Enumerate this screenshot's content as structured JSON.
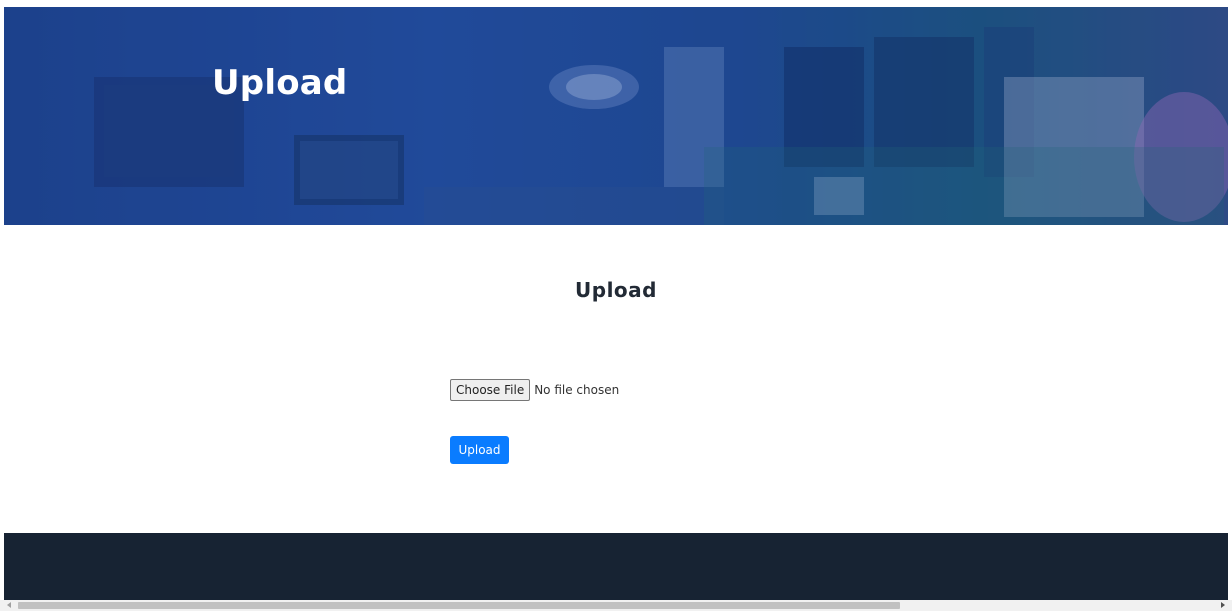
{
  "hero": {
    "title": "Upload"
  },
  "main": {
    "heading": "Upload",
    "file_input": {
      "button_label": "Choose File",
      "status": "No file chosen"
    },
    "submit_label": "Upload"
  },
  "colors": {
    "hero_overlay": "#1f4a9c",
    "primary_button": "#0a7cff",
    "footer": "#172333",
    "heading_text": "#222a35"
  }
}
